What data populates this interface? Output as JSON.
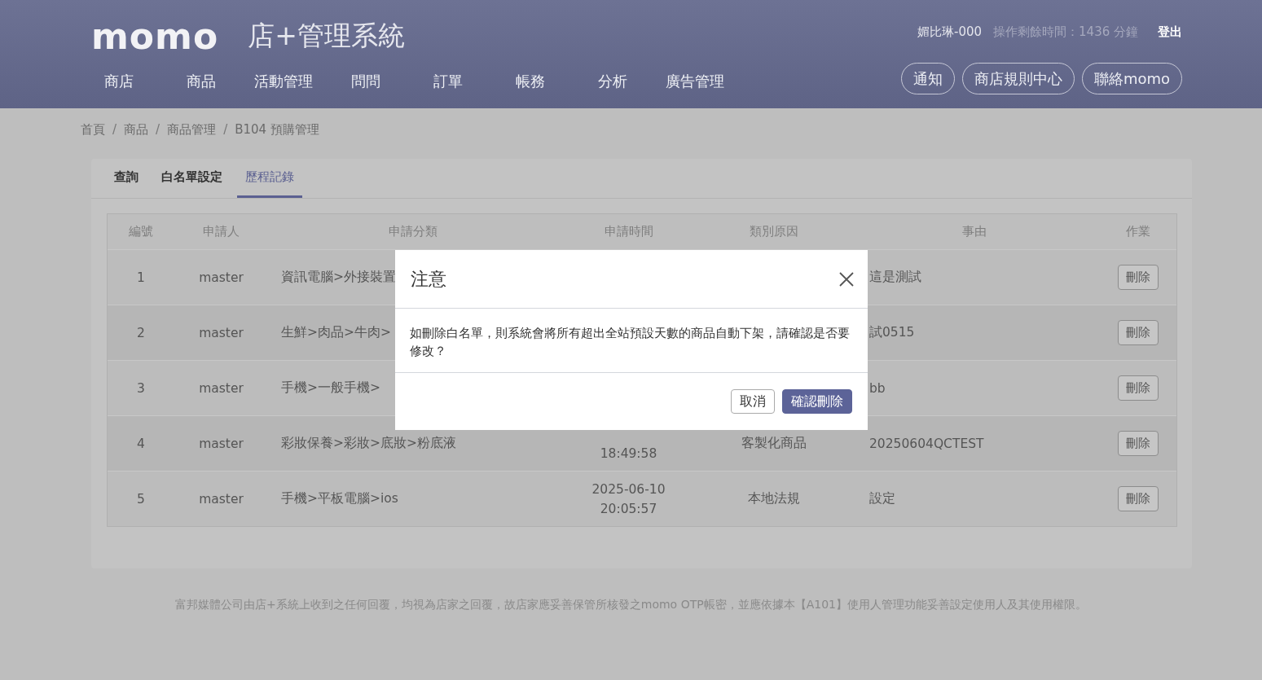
{
  "header": {
    "logo": "momo",
    "system_title": "店+管理系統",
    "nav": [
      "商店",
      "商品",
      "活動管理",
      "問問",
      "訂單",
      "帳務",
      "分析",
      "廣告管理"
    ],
    "user": "媚比琳-000",
    "session_time": "操作剩餘時間：1436 分鐘",
    "logout": "登出",
    "buttons": [
      "通知",
      "商店規則中心",
      "聯絡momo"
    ]
  },
  "breadcrumb": {
    "separator": "/",
    "items": [
      "首頁",
      "商品",
      "商品管理",
      "B104 預購管理"
    ]
  },
  "tabs": [
    {
      "label": "查詢",
      "selected": false
    },
    {
      "label": "白名單設定",
      "selected": false
    },
    {
      "label": "歷程記錄",
      "selected": true
    }
  ],
  "table": {
    "columns": [
      "編號",
      "申請人",
      "申請分類",
      "申請時間",
      "類別原因",
      "事由",
      "作業"
    ],
    "rows": [
      {
        "number": "1",
        "applicant": "master",
        "category": "資訊電腦>外接裝置",
        "reason": "這是測試",
        "action": "刪除"
      },
      {
        "number": "2",
        "applicant": "master",
        "category": "生鮮>肉品>牛肉>",
        "reason": "試0515",
        "action": "刪除"
      },
      {
        "number": "3",
        "applicant": "master",
        "category": "手機>一般手機>",
        "reason": "bb",
        "action": "刪除"
      },
      {
        "number": "4",
        "applicant": "master",
        "category": "彩妝保養>彩妝>底妝>粉底液",
        "time": [
          "18:49:58"
        ],
        "reason_type": "客製化商品",
        "reason": "20250604QCTEST",
        "action": "刪除"
      },
      {
        "number": "5",
        "applicant": "master",
        "category": "手機>平板電腦>ios",
        "time": [
          "2025-06-10",
          "20:05:57"
        ],
        "reason_type": "本地法規",
        "reason": "設定",
        "action": "刪除"
      }
    ]
  },
  "footer": "富邦媒體公司由店+系統上收到之任何回覆，均視為店家之回覆，故店家應妥善保管所核發之momo OTP帳密，並應依據本【A101】使用人管理功能妥善設定使用人及其使用權限。",
  "modal": {
    "title": "注意",
    "message": "如刪除白名單，則系統會將所有超出全站預設天數的商品自動下架，請確認是否要修改？",
    "buttons": [
      {
        "label": "取消",
        "kind": "secondary"
      },
      {
        "label": "確認刪除",
        "kind": "primary"
      }
    ]
  }
}
